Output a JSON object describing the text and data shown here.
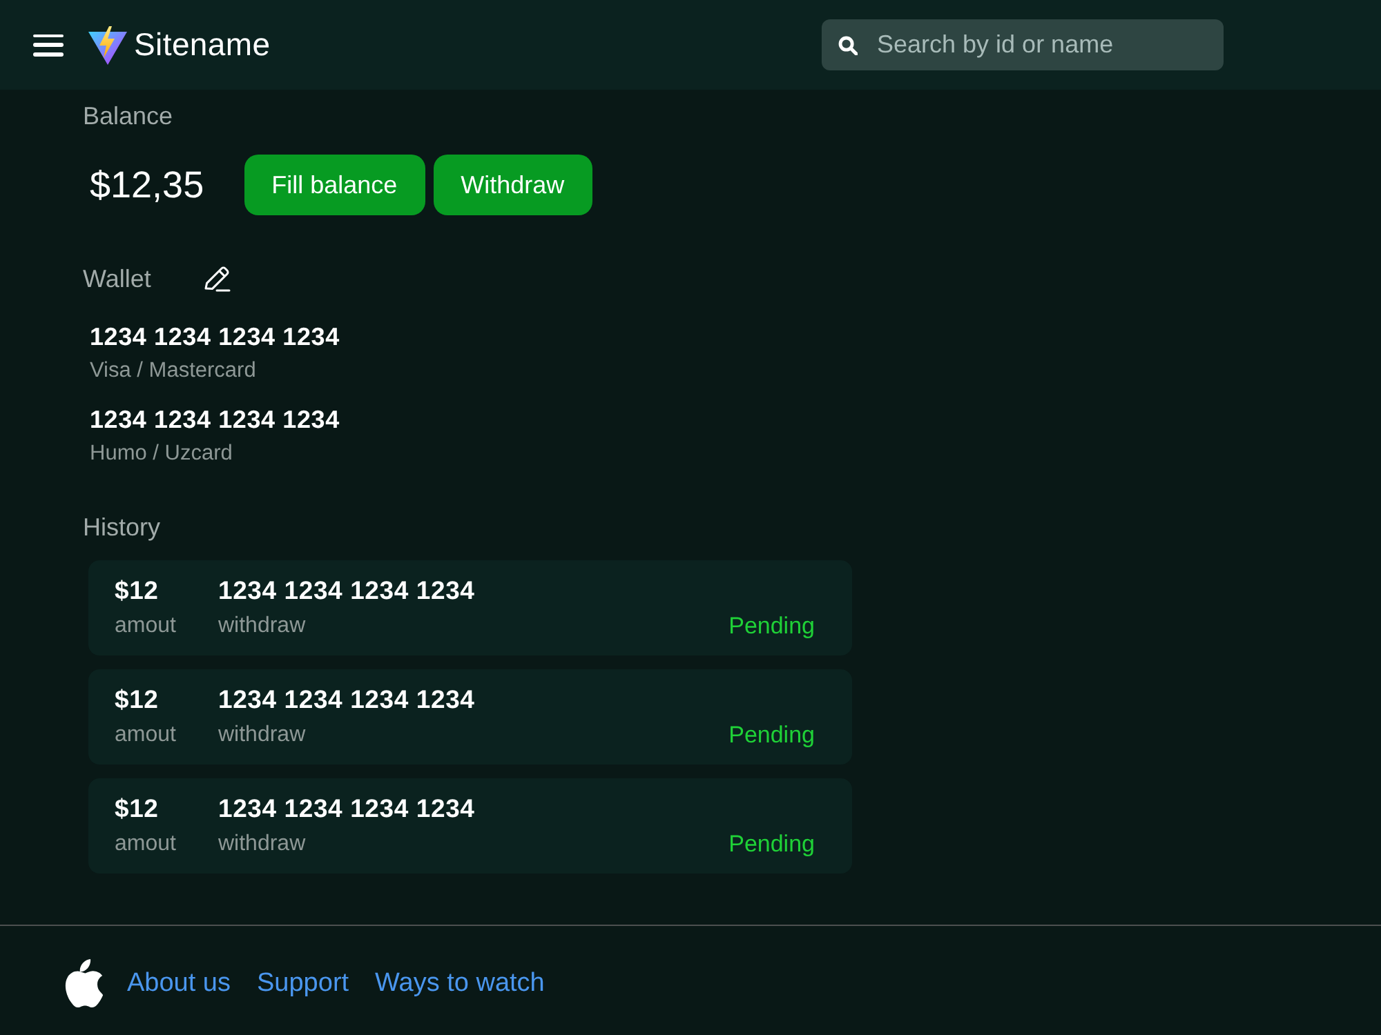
{
  "header": {
    "site_name": "Sitename",
    "search": {
      "placeholder": "Search by id or name"
    }
  },
  "balance": {
    "label": "Balance",
    "amount": "$12,35",
    "buttons": [
      "Fill balance",
      "Withdraw"
    ]
  },
  "wallet": {
    "label": "Wallet",
    "cards": [
      {
        "number": "1234 1234 1234 1234",
        "type": "Visa / Mastercard"
      },
      {
        "number": "1234 1234 1234 1234",
        "type": "Humo / Uzcard"
      }
    ]
  },
  "history": {
    "label": "History",
    "items": [
      {
        "amount": "$12",
        "amount_label": "amout",
        "card": "1234 1234 1234 1234",
        "type": "withdraw",
        "status": "Pending"
      },
      {
        "amount": "$12",
        "amount_label": "amout",
        "card": "1234 1234 1234 1234",
        "type": "withdraw",
        "status": "Pending"
      },
      {
        "amount": "$12",
        "amount_label": "amout",
        "card": "1234 1234 1234 1234",
        "type": "withdraw",
        "status": "Pending"
      }
    ]
  },
  "footer": {
    "links": [
      "About us",
      "Support",
      "Ways to watch"
    ]
  }
}
